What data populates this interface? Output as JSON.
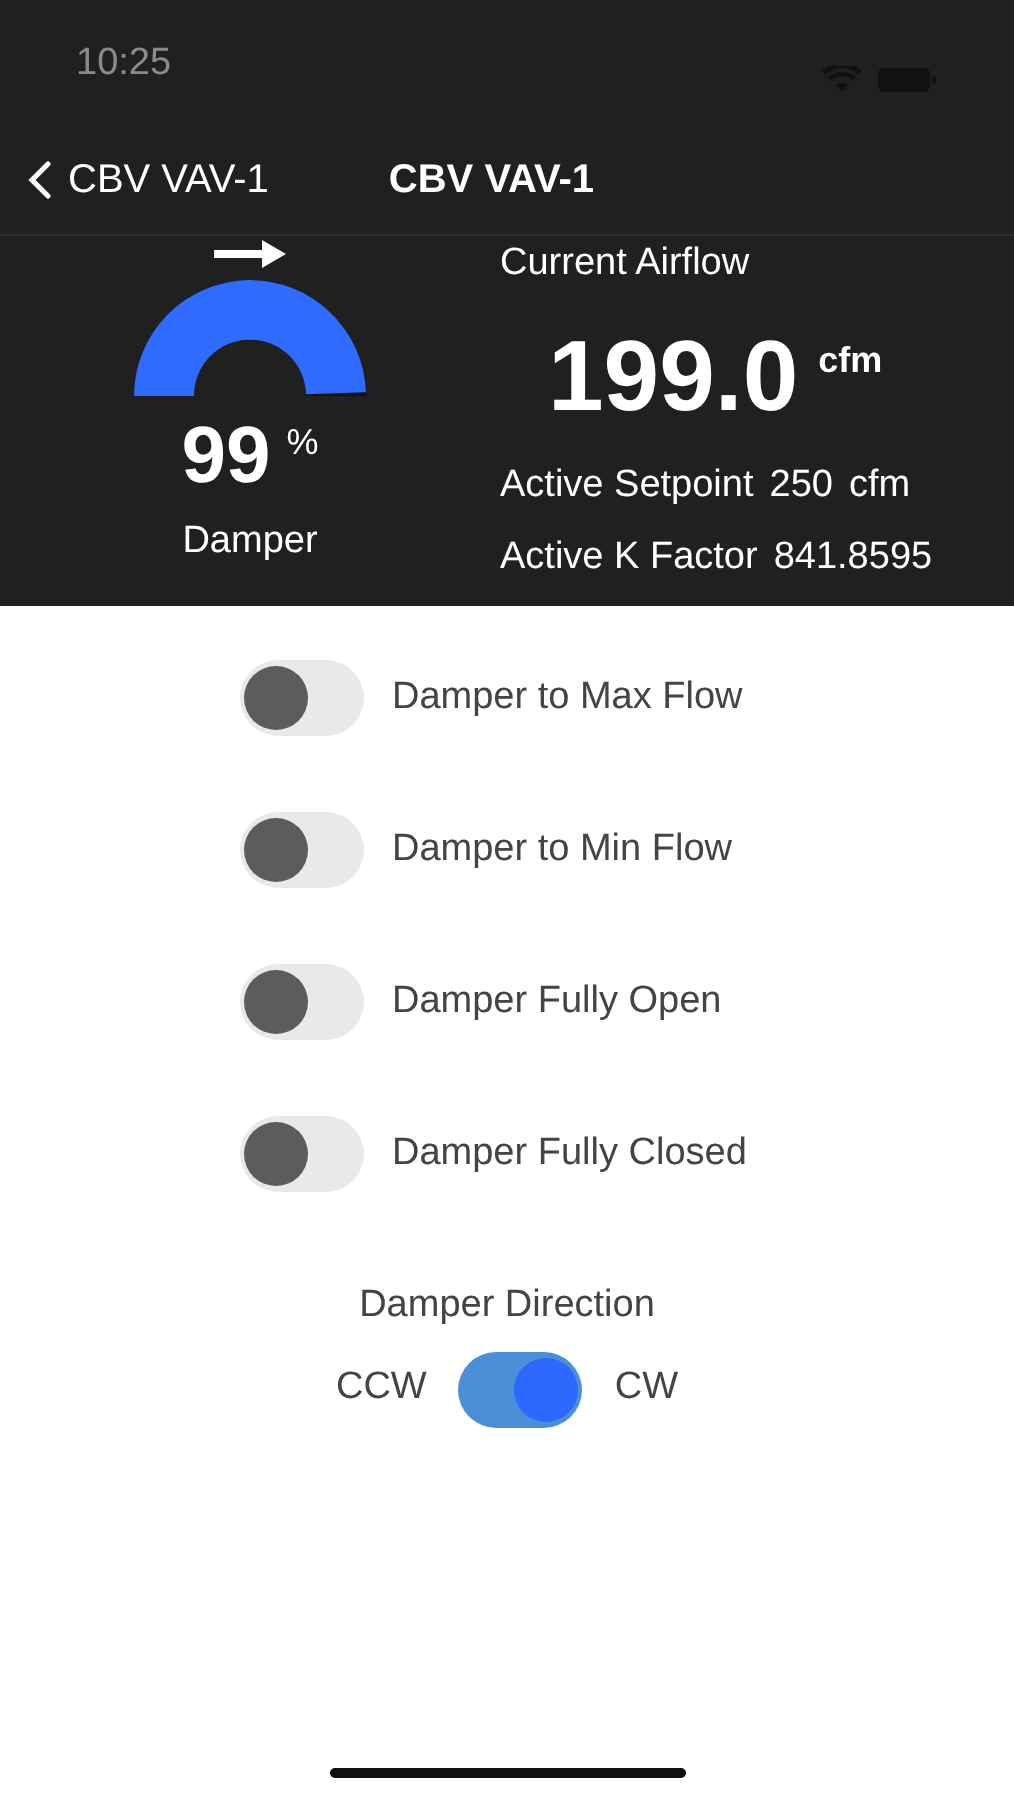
{
  "status_bar": {
    "time": "10:25"
  },
  "nav": {
    "back_label": "CBV VAV-1",
    "title": "CBV VAV-1"
  },
  "damper": {
    "level": 0.99,
    "value": "99",
    "unit": "%",
    "label": "Damper"
  },
  "airflow": {
    "title": "Current Airflow",
    "value": "199.0",
    "unit": "cfm",
    "setpoint_label": "Active Setpoint",
    "setpoint_value": "250",
    "setpoint_unit": "cfm",
    "kfactor_label": "Active K Factor",
    "kfactor_value": "841.8595"
  },
  "toggles": [
    {
      "label": "Damper to Max Flow",
      "on": false
    },
    {
      "label": "Damper to Min Flow",
      "on": false
    },
    {
      "label": "Damper Fully Open",
      "on": false
    },
    {
      "label": "Damper Fully Closed",
      "on": false
    }
  ],
  "direction": {
    "title": "Damper Direction",
    "left": "CCW",
    "right": "CW",
    "on": true
  }
}
